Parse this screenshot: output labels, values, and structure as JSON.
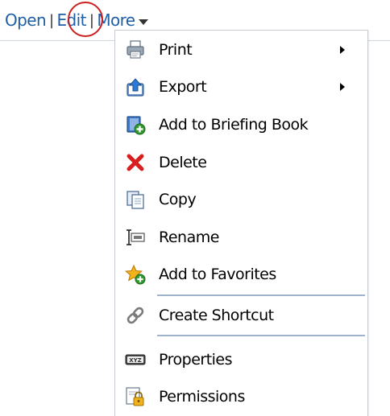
{
  "toolbar": {
    "open_label": "Open",
    "edit_label": "Edit",
    "more_label": "More",
    "separator": "|"
  },
  "menu": {
    "items": [
      {
        "label": "Print",
        "icon": "printer-icon",
        "has_submenu": true
      },
      {
        "label": "Export",
        "icon": "export-icon",
        "has_submenu": true
      },
      {
        "label": "Add to Briefing Book",
        "icon": "add-to-briefing-book-icon",
        "has_submenu": false
      },
      {
        "label": "Delete",
        "icon": "delete-icon",
        "has_submenu": false
      },
      {
        "label": "Copy",
        "icon": "copy-icon",
        "has_submenu": false
      },
      {
        "label": "Rename",
        "icon": "rename-icon",
        "has_submenu": false
      },
      {
        "label": "Add to Favorites",
        "icon": "add-to-favorites-icon",
        "has_submenu": false
      },
      {
        "label": "Create Shortcut",
        "icon": "shortcut-link-icon",
        "has_submenu": false
      },
      {
        "label": "Properties",
        "icon": "properties-icon",
        "has_submenu": false
      },
      {
        "label": "Permissions",
        "icon": "permissions-lock-icon",
        "has_submenu": false
      }
    ]
  },
  "colors": {
    "link": "#1f5fa8",
    "highlight": "#cc1f1f",
    "separator": "#9fb4cc",
    "delete_red": "#d81e1e",
    "add_green": "#2e9a2e"
  }
}
